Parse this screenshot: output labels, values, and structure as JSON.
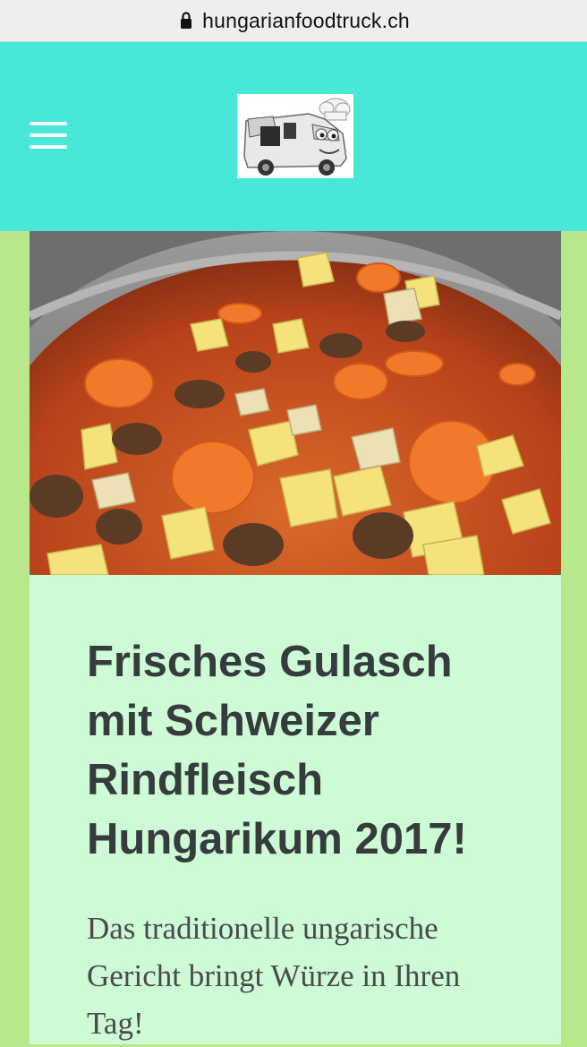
{
  "browser": {
    "url": "hungarianfoodtruck.ch"
  },
  "header": {
    "menu_icon": "hamburger-menu-icon",
    "logo": "food-truck-logo",
    "colors": {
      "header_bg": "#48e8d8",
      "page_bg": "#b9e88a"
    }
  },
  "post": {
    "image": "goulash-pot-photo",
    "title": "Frisches Gulasch mit Schweizer Rindfleisch Hungarikum 2017!",
    "excerpt": "Das traditionelle ungarische Gericht bringt Würze in Ihren Tag!",
    "card_bg": "#ccfbd5"
  }
}
